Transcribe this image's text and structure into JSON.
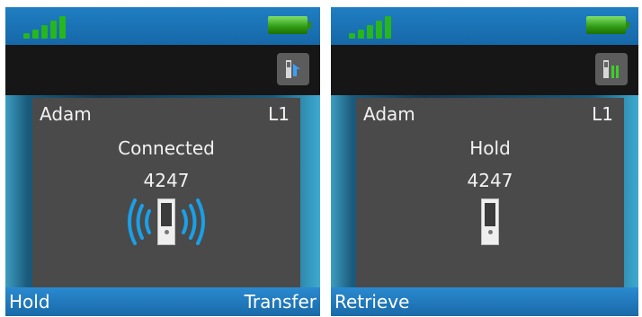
{
  "screens": [
    {
      "contact_name": "Adam",
      "line_label": "L1",
      "call_state": "Connected",
      "number": "4247",
      "action_icon": "transfer-call-icon",
      "call_indicator": "phone-ringing-waves-icon",
      "softkeys": {
        "left": "Hold",
        "right": "Transfer"
      }
    },
    {
      "contact_name": "Adam",
      "line_label": "L1",
      "call_state": "Hold",
      "number": "4247",
      "action_icon": "call-on-hold-icon",
      "call_indicator": "phone-handset-icon",
      "softkeys": {
        "left": "Retrieve",
        "right": ""
      }
    }
  ],
  "colors": {
    "status_bar": "#1f7ec2",
    "signal": "#27b61d",
    "battery": "#2f9a12",
    "softkey_bar": "#2a8ad0",
    "panel": "#4a4a4a",
    "wave": "#1aa0e8"
  }
}
